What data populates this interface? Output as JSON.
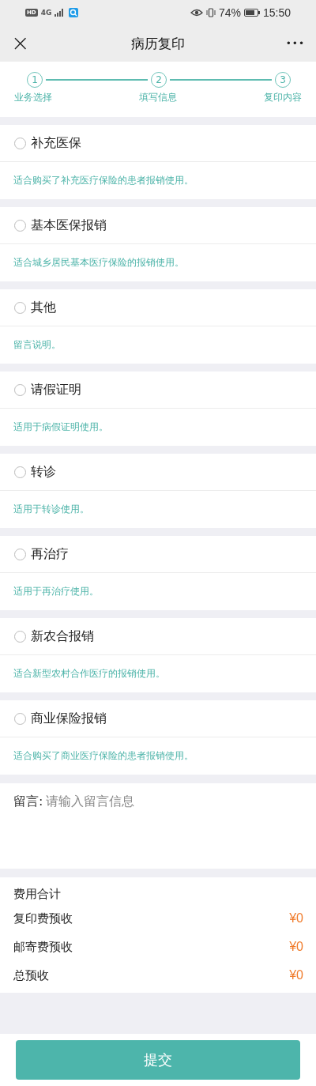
{
  "status_bar": {
    "hd": "HD",
    "network": "4G",
    "battery": "74%",
    "time": "15:50"
  },
  "nav": {
    "close": "×",
    "title": "病历复印",
    "more": "•••"
  },
  "steps": [
    {
      "number": "1",
      "label": "业务选择"
    },
    {
      "number": "2",
      "label": "填写信息"
    },
    {
      "number": "3",
      "label": "复印内容"
    }
  ],
  "options": [
    {
      "label": "补充医保",
      "description": "适合购买了补充医疗保险的患者报销使用。",
      "selected": false
    },
    {
      "label": "基本医保报销",
      "description": "适合城乡居民基本医疗保险的报销使用。",
      "selected": false
    },
    {
      "label": "其他",
      "description": "留言说明。",
      "selected": false
    },
    {
      "label": "请假证明",
      "description": "适用于病假证明使用。",
      "selected": false
    },
    {
      "label": "转诊",
      "description": "适用于转诊使用。",
      "selected": false
    },
    {
      "label": "再治疗",
      "description": "适用于再治疗使用。",
      "selected": false
    },
    {
      "label": "新农合报销",
      "description": "适合新型农村合作医疗的报销使用。",
      "selected": false
    },
    {
      "label": "商业保险报销",
      "description": "适合购买了商业医疗保险的患者报销使用。",
      "selected": false
    }
  ],
  "message": {
    "label": "留言:",
    "placeholder": "请输入留言信息"
  },
  "fees": {
    "title": "费用合计",
    "rows": [
      {
        "label": "复印费预收",
        "amount": "¥0"
      },
      {
        "label": "邮寄费预收",
        "amount": "¥0"
      },
      {
        "label": "总预收",
        "amount": "¥0"
      }
    ]
  },
  "submit": "提交"
}
